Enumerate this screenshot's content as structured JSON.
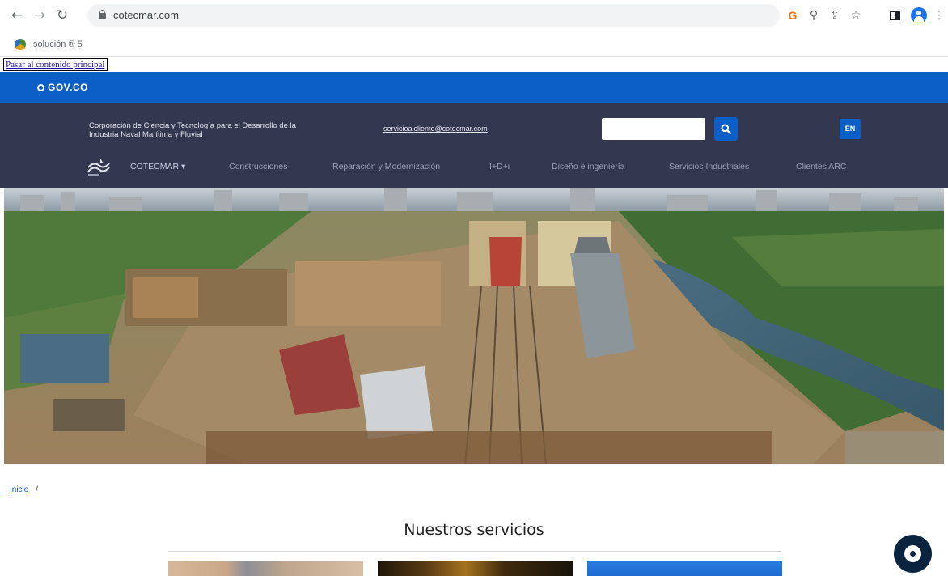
{
  "browser": {
    "url": "cotecmar.com",
    "bookmark": {
      "label": "Isolución ® 5"
    }
  },
  "skip_link": "Pasar al contenido principal",
  "gov_bar": {
    "logo_text": "GOV.CO"
  },
  "header": {
    "corporation_name": "Corporación de Ciencia y Tecnología para el Desarrollo de la Industria Naval Marítima y Fluvial",
    "contact_email": "servicioalcliente@cotecmar.com",
    "search": {
      "placeholder": ""
    },
    "language_button": "EN"
  },
  "nav": {
    "items": [
      {
        "label": "COTECMAR ▾"
      },
      {
        "label": "Construcciones"
      },
      {
        "label": "Reparación y Modernización"
      },
      {
        "label": "I+D+i"
      },
      {
        "label": "Diseño e ingeniería"
      },
      {
        "label": "Servicios Industriales"
      },
      {
        "label": "Clientes ARC"
      }
    ]
  },
  "breadcrumb": {
    "home": "Inicio",
    "separator": "/"
  },
  "section": {
    "title": "Nuestros servicios"
  },
  "colors": {
    "gov_blue": "#0b5fc6",
    "header_bg": "#33374f",
    "chat_bg": "#0a2440"
  }
}
